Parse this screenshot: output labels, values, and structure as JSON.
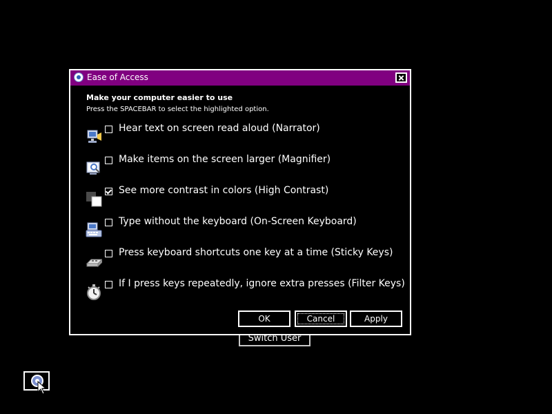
{
  "background_button": {
    "label": "Switch User"
  },
  "dialog": {
    "title": "Ease of Access",
    "heading": "Make your computer easier to use",
    "instruction": "Press the SPACEBAR to select the highlighted option.",
    "options": [
      {
        "label": "Hear text on screen read aloud (Narrator)",
        "checked": false,
        "icon": "narrator-icon"
      },
      {
        "label": "Make items on the screen larger (Magnifier)",
        "checked": false,
        "icon": "magnifier-icon"
      },
      {
        "label": "See more contrast in colors (High Contrast)",
        "checked": true,
        "icon": "high-contrast-icon"
      },
      {
        "label": "Type without the keyboard (On-Screen Keyboard)",
        "checked": false,
        "icon": "on-screen-keyboard-icon"
      },
      {
        "label": "Press keyboard shortcuts one key at a time (Sticky Keys)",
        "checked": false,
        "icon": "sticky-keys-icon"
      },
      {
        "label": "If I press keys repeatedly, ignore extra presses (Filter Keys)",
        "checked": false,
        "icon": "filter-keys-icon"
      }
    ],
    "buttons": {
      "ok": "OK",
      "cancel": "Cancel",
      "apply": "Apply"
    }
  },
  "colors": {
    "title_bar": "#800080",
    "background": "#000000",
    "foreground": "#ffffff"
  }
}
